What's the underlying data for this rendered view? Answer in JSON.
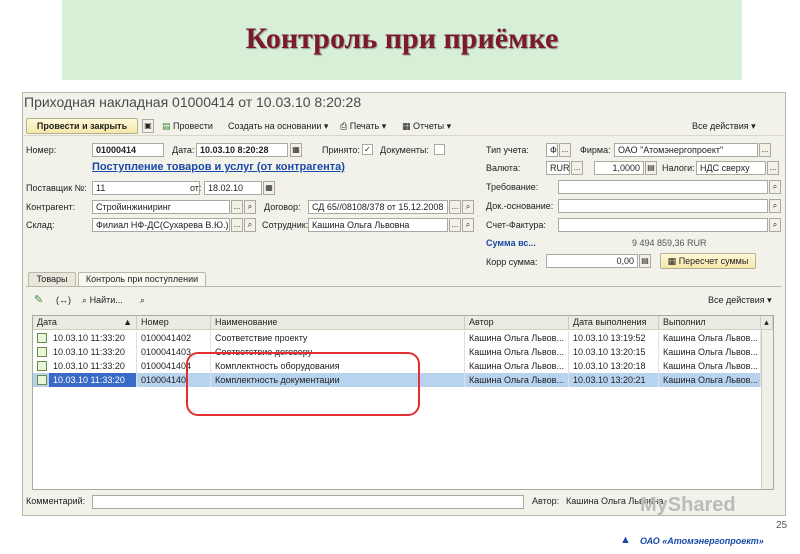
{
  "slide": {
    "title": "Контроль при приёмке",
    "page_number": "25",
    "watermark": "MyShared",
    "company_logo": "ОАО «Атомэнергопроект»"
  },
  "window": {
    "title": "Приходная накладная 01000414 от 10.03.10 8:20:28"
  },
  "toolbar": {
    "post_close": "Провести и закрыть",
    "post": "Провести",
    "create_based": "Создать на основании",
    "print": "Печать",
    "reports": "Отчеты",
    "all_actions": "Все действия"
  },
  "form": {
    "number_label": "Номер:",
    "number_value": "01000414",
    "date_label": "Дата:",
    "date_value": "10.03.10  8:20:28",
    "accepted_label": "Принято:",
    "documents_label": "Документы:",
    "operation_link": "Поступление товаров и услуг (от контрагента)",
    "supplier_no_label": "Поставщик №:",
    "supplier_no_value": "11",
    "from_label": "от:",
    "from_value": "18.02.10",
    "counterparty_label": "Контрагент:",
    "counterparty_value": "Стройинжиниринг",
    "contract_label": "Договор:",
    "contract_value": "СД 65//08108/378 от 15.12.2008",
    "warehouse_label": "Склад:",
    "warehouse_value": "Филиал НФ-ДС(Сухарева В.Ю.)",
    "employee_label": "Сотрудник:",
    "employee_value": "Кашина Ольга Львовна",
    "accounting_type_label": "Тип учета:",
    "accounting_type_value": "Ф",
    "firm_label": "Фирма:",
    "firm_value": "ОАО \"Атомэнергопроект\"",
    "currency_label": "Валюта:",
    "currency_value": "RUR",
    "rate_value": "1,0000",
    "taxes_label": "Налоги:",
    "taxes_value": "НДС сверху",
    "requirement_label": "Требование:",
    "basis_label": "Док.-основание:",
    "invoice_label": "Счет-Фактура:",
    "sum_label": "Сумма вс...",
    "sum_value": "9 494 859,36  RUR",
    "corr_sum_label": "Корр сумма:",
    "corr_sum_value": "0,00",
    "recalc_button": "Пересчет суммы"
  },
  "tabs": [
    {
      "label": "Товары"
    },
    {
      "label": "Контроль при поступлении"
    }
  ],
  "grid_toolbar": {
    "find": "Найти...",
    "all_actions": "Все действия"
  },
  "grid": {
    "headers": [
      "Дата",
      "Номер",
      "Наименование",
      "Автор",
      "Дата выполнения",
      "Выполнил"
    ],
    "rows": [
      [
        "10.03.10 11:33:20",
        "0100041402",
        "Соответствие проекту",
        "Кашина Ольга Львов...",
        "10.03.10 13:19:52",
        "Кашина Ольга Львов..."
      ],
      [
        "10.03.10 11:33:20",
        "0100041403",
        "Соответствие договору",
        "Кашина Ольга Львов...",
        "10.03.10 13:20:15",
        "Кашина Ольга Львов..."
      ],
      [
        "10.03.10 11:33:20",
        "0100041404",
        "Комплектность оборудования",
        "Кашина Ольга Львов...",
        "10.03.10 13:20:18",
        "Кашина Ольга Львов..."
      ],
      [
        "10.03.10 11:33:20",
        "010004140",
        "Комплектность документации",
        "Кашина Ольга Львов...",
        "10.03.10 13:20:21",
        "Кашина Ольга Львов..."
      ]
    ]
  },
  "footer": {
    "comment_label": "Комментарий:",
    "author_label": "Автор:",
    "author_value": "Кашина Ольга Львовна"
  }
}
